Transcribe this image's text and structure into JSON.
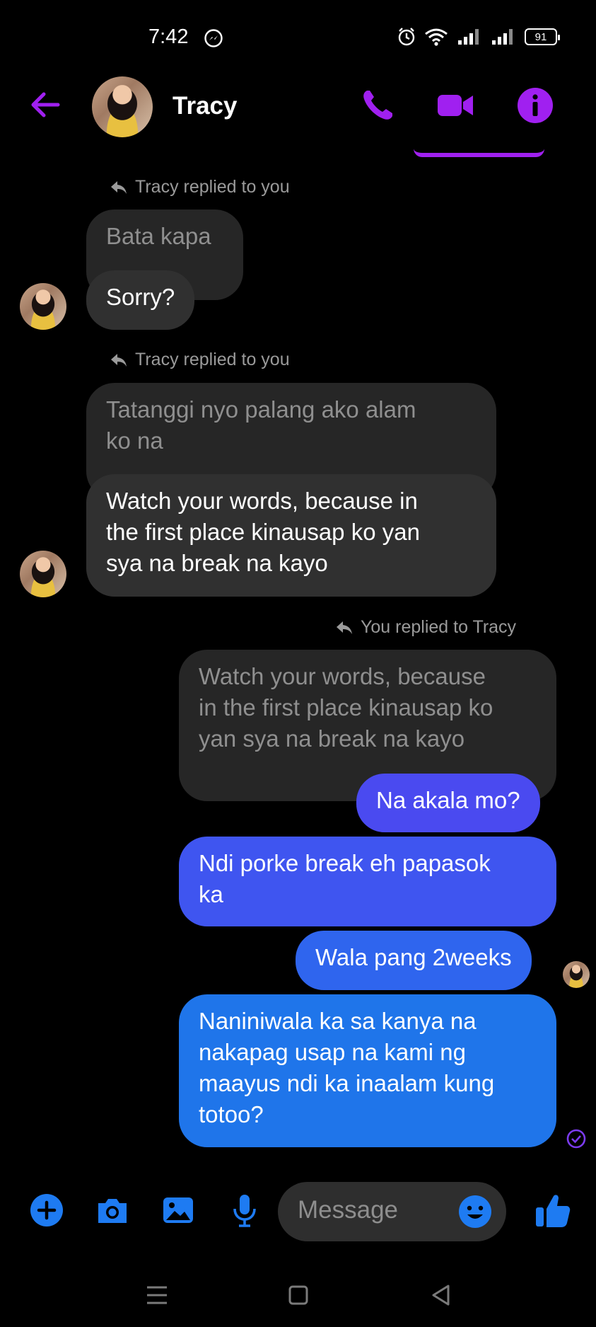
{
  "status_bar": {
    "time": "7:42",
    "battery": "91",
    "icons": [
      "messenger-icon",
      "alarm-icon",
      "wifi-icon",
      "signal-icon",
      "signal-icon",
      "battery-icon"
    ]
  },
  "header": {
    "contact_name": "Tracy",
    "accent_color": "#a020f0",
    "icons": [
      "back-arrow-icon",
      "phone-icon",
      "video-camera-icon",
      "info-icon"
    ]
  },
  "conversation": {
    "groups": [
      {
        "reply_label": "Tracy replied to you",
        "quoted": "Bata kapa",
        "messages": [
          "Sorry?"
        ]
      },
      {
        "reply_label": "Tracy replied to you",
        "quoted": "Tatanggi nyo palang ako alam\nko na",
        "messages": [
          "Watch your words, because in\nthe first place kinausap ko yan\nsya na break na kayo"
        ]
      },
      {
        "reply_label": "You replied to Tracy",
        "quoted": "Watch your words, because\nin the first place kinausap ko\nyan sya na break na kayo",
        "messages": [
          "Na akala mo?",
          "Ndi porke break eh papasok\nka",
          "Wala pang 2weeks",
          "Naniniwala ka sa kanya na\nnakapag usap na kami ng\nmaayus ndi ka inaalam kung\ntotoo?"
        ]
      }
    ],
    "outgoing_colors": [
      "#4a4af0",
      "#3f55f0",
      "#2f65ee",
      "#1f75ea"
    ]
  },
  "composer": {
    "placeholder": "Message",
    "accent_color": "#1e7bf2",
    "icons": [
      "plus-icon",
      "camera-icon",
      "image-icon",
      "microphone-icon",
      "emoji-icon",
      "thumbs-up-icon"
    ]
  },
  "nav_bar": {
    "icons": [
      "menu-icon",
      "home-icon",
      "back-icon"
    ]
  }
}
